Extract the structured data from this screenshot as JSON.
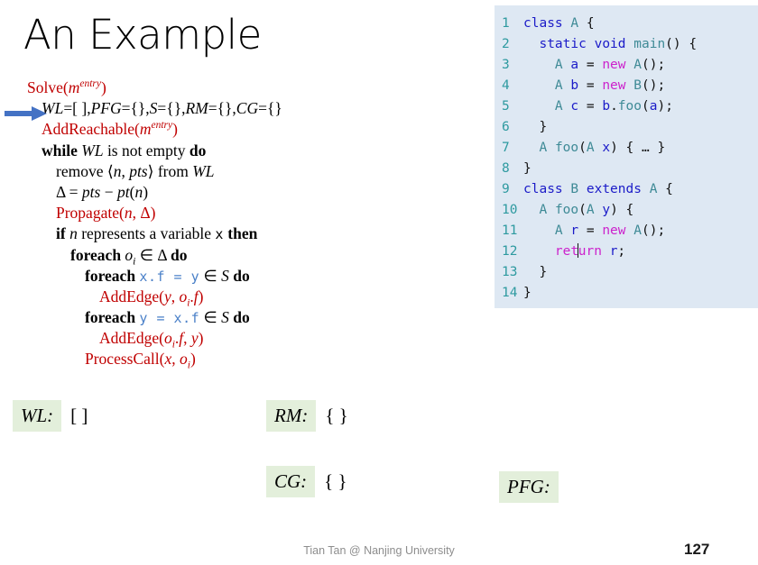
{
  "slide": {
    "title": "An Example",
    "page_number": "127",
    "footer": "Tian Tan @ Nanjing University",
    "accent_red": "#C00000",
    "accent_blue": "#4A80C8",
    "arrow_color": "#4472C4",
    "code_bg": "#DEE8F3",
    "label_bg": "#E3EFDB"
  },
  "pseudocode": {
    "lines": [
      {
        "id": "solve-header",
        "text": "Solve(m entry)"
      },
      {
        "id": "init-worklist",
        "text": "WL=[ ],PFG={},S={},RM={},CG={}"
      },
      {
        "id": "add-reachable",
        "text": "AddReachable(m entry)"
      },
      {
        "id": "while-wl",
        "text": "while WL is not empty do"
      },
      {
        "id": "remove-pts",
        "text": "remove ⟨n, pts⟩ from WL"
      },
      {
        "id": "delta-assign",
        "text": "Δ = pts − pt(n)"
      },
      {
        "id": "propagate-call",
        "text": "Propagate(n, Δ)"
      },
      {
        "id": "if-represents",
        "text": "if n represents a variable x then"
      },
      {
        "id": "foreach-oi",
        "text": "foreach oᵢ ∈ Δ do"
      },
      {
        "id": "foreach-store",
        "text": "foreach x.f = y ∈ S do"
      },
      {
        "id": "addedge-store",
        "text": "AddEdge(y, oᵢ.f)"
      },
      {
        "id": "foreach-load",
        "text": "foreach y = x.f ∈ S do"
      },
      {
        "id": "addedge-load",
        "text": "AddEdge(oᵢ.f, y)"
      },
      {
        "id": "processcall",
        "text": "ProcessCall(x, oᵢ)"
      }
    ],
    "marker": "right-arrow-pointing-at-init-line"
  },
  "code": {
    "language": "java",
    "cursor_line": 12,
    "cursor_after": "ret",
    "lines": [
      {
        "n": "1",
        "text": "class A {"
      },
      {
        "n": "2",
        "text": "  static void main() {"
      },
      {
        "n": "3",
        "text": "    A a = new A();"
      },
      {
        "n": "4",
        "text": "    A b = new B();"
      },
      {
        "n": "5",
        "text": "    A c = b.foo(a);"
      },
      {
        "n": "6",
        "text": "  }"
      },
      {
        "n": "7",
        "text": "  A foo(A x) { … }"
      },
      {
        "n": "8",
        "text": "}"
      },
      {
        "n": "9",
        "text": "class B extends A {"
      },
      {
        "n": "10",
        "text": "  A foo(A y) {"
      },
      {
        "n": "11",
        "text": "    A r = new A();"
      },
      {
        "n": "12",
        "text": "    return r;"
      },
      {
        "n": "13",
        "text": "  }"
      },
      {
        "n": "14",
        "text": "}"
      }
    ]
  },
  "state": {
    "wl": {
      "name": "WL:",
      "value": "[ ]"
    },
    "rm": {
      "name": "RM:",
      "value": "{ }"
    },
    "cg": {
      "name": "CG:",
      "value": "{ }"
    },
    "pfg": {
      "name": "PFG:",
      "value": ""
    }
  }
}
